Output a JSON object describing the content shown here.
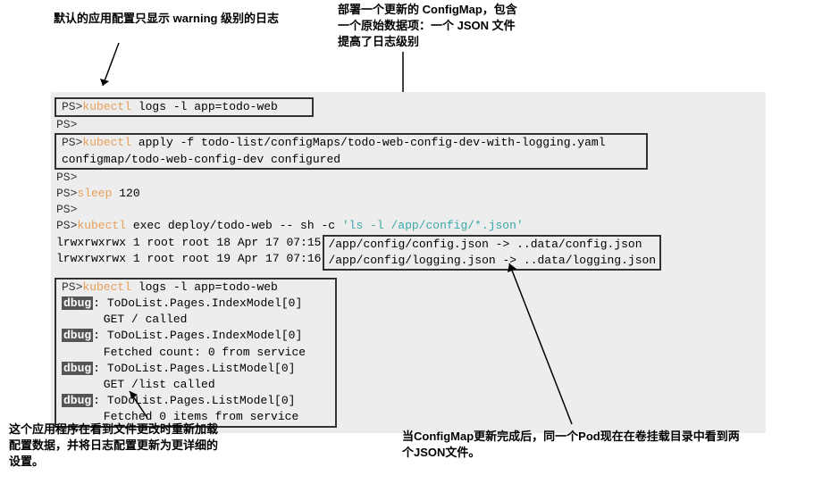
{
  "annotations": {
    "a1": "默认的应用配置只显示 warning 级别的日志",
    "a2_line1": "部署一个更新的 ConfigMap，包含",
    "a2_line2": "一个原始数据项：一个 JSON 文件",
    "a2_line3": "提高了日志级别",
    "a3_line1": "这个应用程序在看到文件更改时重新加载",
    "a3_line2": "配置数据，并将日志配置更新为更详细的",
    "a3_line3": "设置。",
    "a4_line1": "当ConfigMap更新完成后，同一个Pod现在在卷挂载目录中看到两",
    "a4_line2": "个JSON文件。"
  },
  "terminal": {
    "ps": "PS>",
    "kubectl": "kubectl",
    "sleep": "sleep",
    "line1_args": " logs -l app=todo-web",
    "line3_args": " apply -f todo-list/configMaps/todo-web-config-dev-with-logging.yaml",
    "line4": "configmap/todo-web-config-dev configured",
    "line6_args": " 120",
    "line8_args": " exec deploy/todo-web -- sh -c ",
    "line8_cmd": "'ls -l /app/config/*.json'",
    "ls_left_1": "lrwxrwxrwx 1 root root 18 Apr 17 07:15",
    "ls_left_2": "lrwxrwxrwx 1 root root 19 Apr 17 07:16",
    "ls_right_1": "/app/config/config.json -> ..data/config.json",
    "ls_right_2": "/app/config/logging.json -> ..data/logging.json",
    "logs2_args": " logs -l app=todo-web",
    "dbug": "dbug",
    "log1_head": ": ToDoList.Pages.IndexModel[0]",
    "log1_body": "      GET / called",
    "log2_head": ": ToDoList.Pages.IndexModel[0]",
    "log2_body": "      Fetched count: 0 from service",
    "log3_head": ": ToDoList.Pages.ListModel[0]",
    "log3_body": "      GET /list called",
    "log4_head": ": ToDoList.Pages.ListModel[0]",
    "log4_body": "      Fetched 0 items from service"
  }
}
